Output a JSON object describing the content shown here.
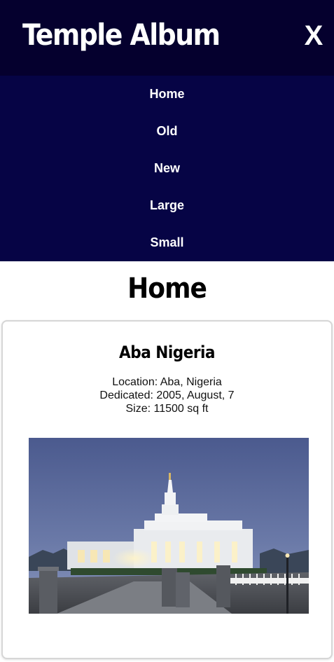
{
  "header": {
    "app_title": "Temple Album",
    "close_label": "X"
  },
  "nav": {
    "items": [
      "Home",
      "Old",
      "New",
      "Large",
      "Small"
    ]
  },
  "main": {
    "page_title": "Home",
    "card": {
      "name": "Aba Nigeria",
      "location_line": "Location: Aba, Nigeria",
      "dedicated_line": "Dedicated: 2005, August, 7",
      "size_line": "Size: 11500 sq ft"
    }
  },
  "colors": {
    "header_bg": "#05002e",
    "nav_bg": "#060445",
    "text_on_dark": "#ffffff"
  }
}
